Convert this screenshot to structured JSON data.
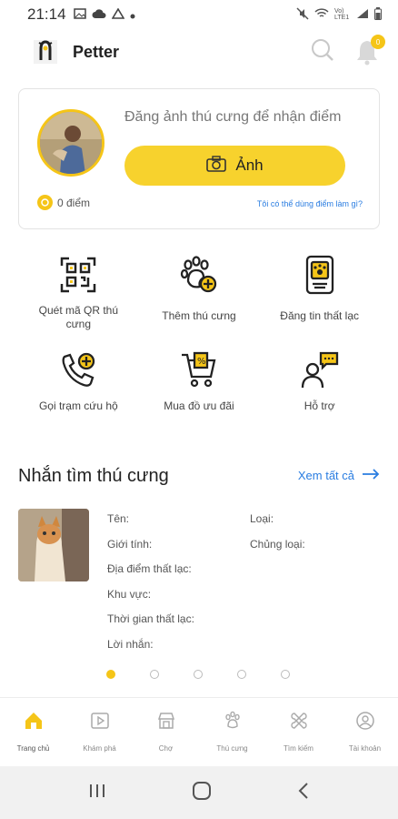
{
  "status_bar": {
    "time": "21:14",
    "signal_text": "Vo) LTE1"
  },
  "header": {
    "app_name": "Petter",
    "notification_count": "0"
  },
  "points_card": {
    "prompt": "Đăng ảnh thú cưng để nhận điểm",
    "photo_button": "Ảnh",
    "points": "0 điểm",
    "points_link": "Tôi có thể dùng điểm làm gì?"
  },
  "actions": [
    {
      "label": "Quét mã QR thú cưng",
      "icon": "qr-code-icon"
    },
    {
      "label": "Thêm thú cưng",
      "icon": "paw-plus-icon"
    },
    {
      "label": "Đăng tin thất lạc",
      "icon": "lost-tag-icon"
    },
    {
      "label": "Gọi trạm cứu hộ",
      "icon": "phone-plus-icon"
    },
    {
      "label": "Mua đồ ưu đãi",
      "icon": "cart-discount-icon"
    },
    {
      "label": "Hỗ trợ",
      "icon": "support-chat-icon"
    }
  ],
  "lost_section": {
    "title": "Nhắn tìm thú cưng",
    "see_all": "Xem tất cả",
    "fields": {
      "name": "Tên:",
      "type": "Loại:",
      "gender": "Giới tính:",
      "breed": "Chủng loại:",
      "lost_place": "Địa điểm thất lạc:",
      "area": "Khu vực:",
      "lost_time": "Thời gian thất lạc:",
      "message": "Lời nhắn:"
    },
    "page_count": 5,
    "active_page": 1
  },
  "bottom_nav": [
    {
      "label": "Trang chủ",
      "icon": "home-icon",
      "active": true
    },
    {
      "label": "Khám phá",
      "icon": "play-icon",
      "active": false
    },
    {
      "label": "Chợ",
      "icon": "store-icon",
      "active": false
    },
    {
      "label": "Thú cưng",
      "icon": "paw-icon",
      "active": false
    },
    {
      "label": "Tìm kiếm",
      "icon": "bone-icon",
      "active": false
    },
    {
      "label": "Tài khoản",
      "icon": "user-icon",
      "active": false
    }
  ],
  "colors": {
    "accent": "#f5c518",
    "link": "#2a7de1"
  }
}
